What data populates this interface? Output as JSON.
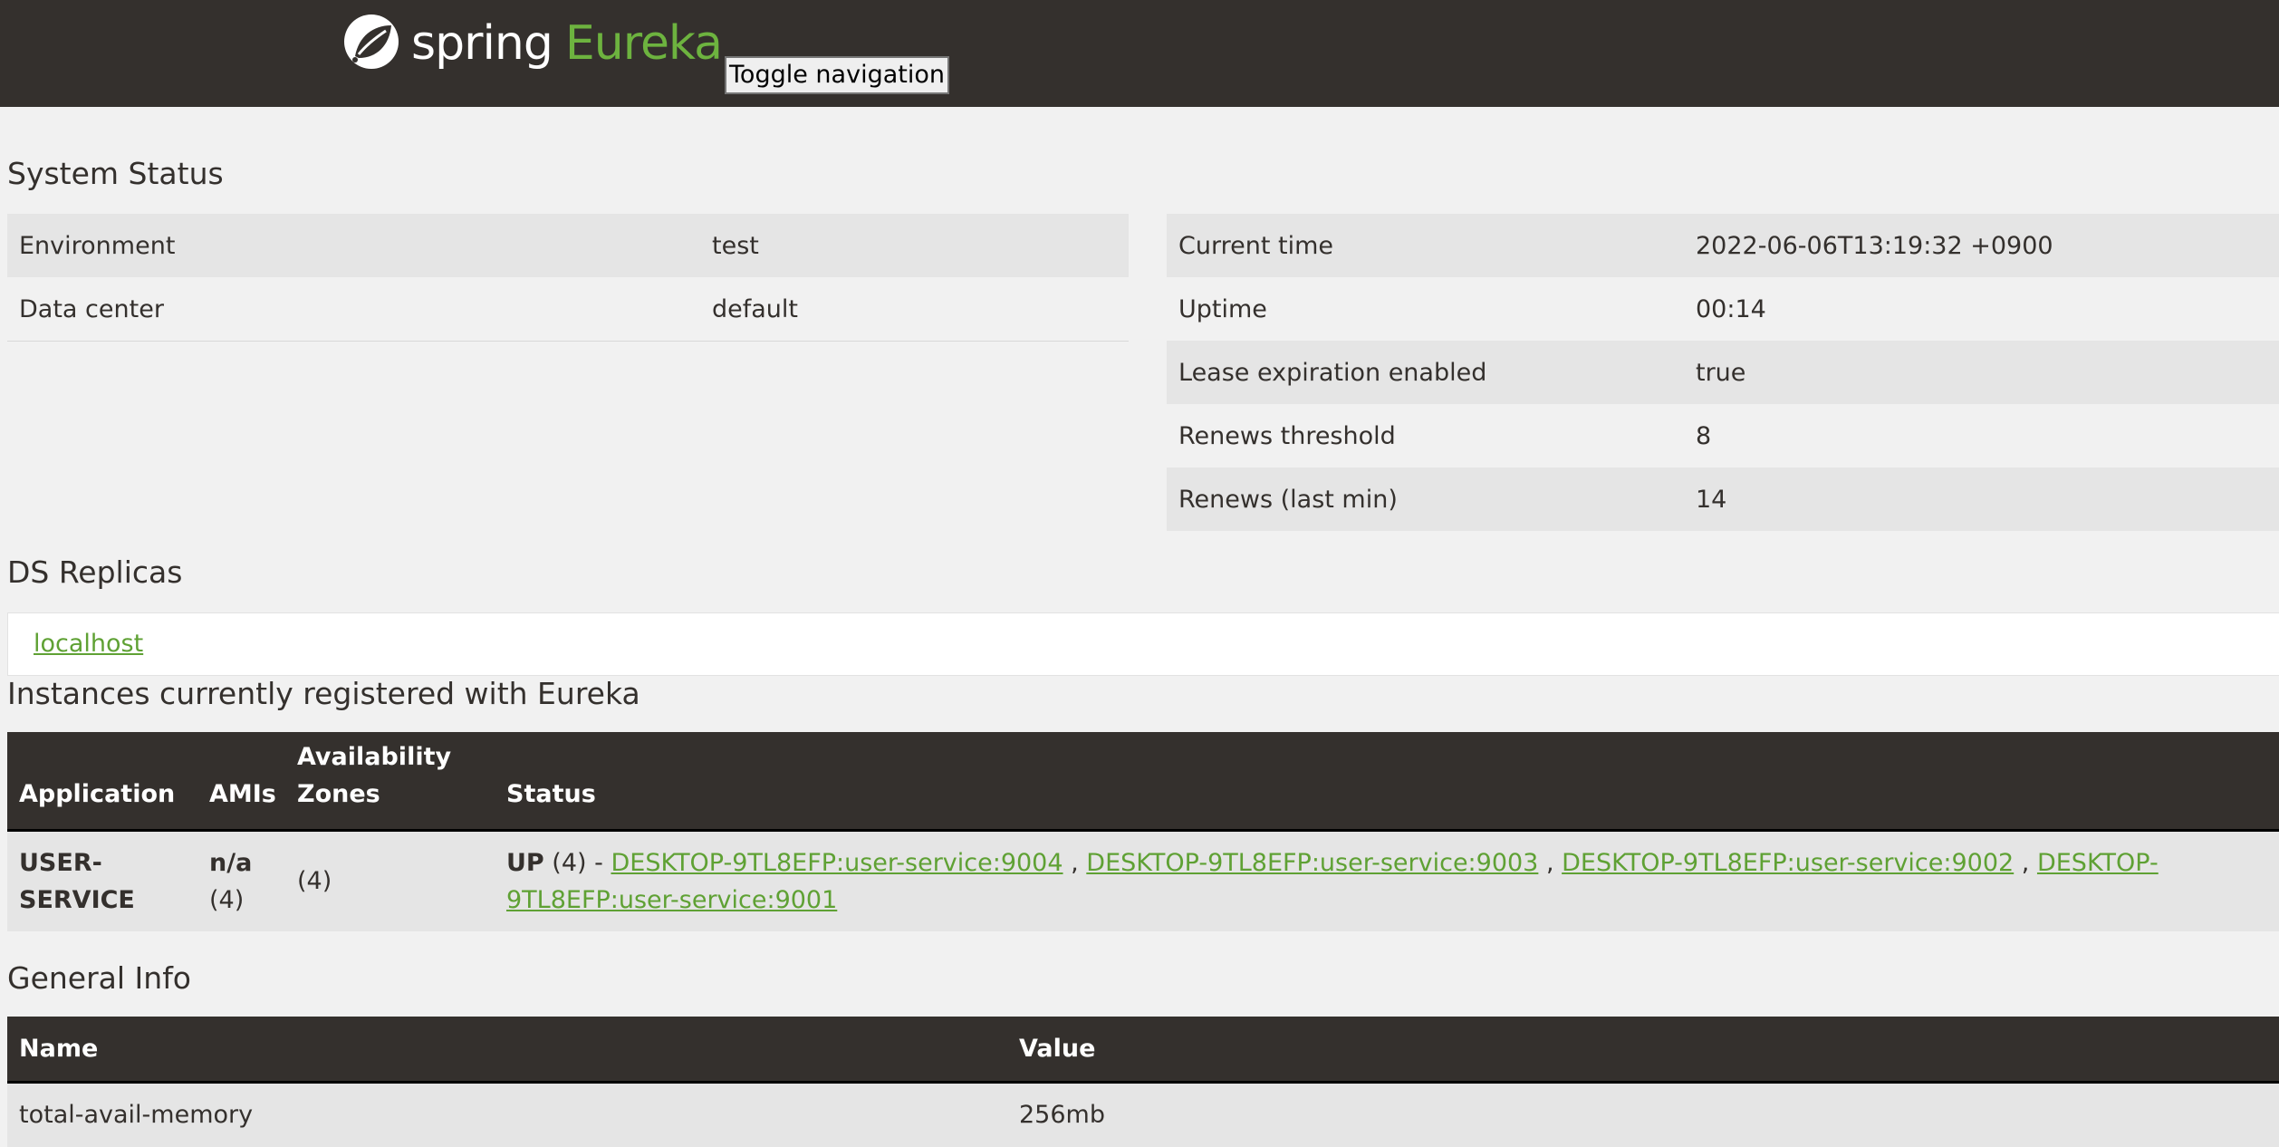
{
  "header": {
    "brand_word": "spring",
    "brand_product": "Eureka",
    "toggle_label": "Toggle navigation"
  },
  "system_status": {
    "title": "System Status",
    "left_rows": [
      {
        "label": "Environment",
        "value": "test"
      },
      {
        "label": "Data center",
        "value": "default"
      }
    ],
    "right_rows": [
      {
        "label": "Current time",
        "value": "2022-06-06T13:19:32 +0900"
      },
      {
        "label": "Uptime",
        "value": "00:14"
      },
      {
        "label": "Lease expiration enabled",
        "value": "true"
      },
      {
        "label": "Renews threshold",
        "value": "8"
      },
      {
        "label": "Renews (last min)",
        "value": "14"
      }
    ]
  },
  "ds_replicas": {
    "title": "DS Replicas",
    "link": "localhost"
  },
  "instances": {
    "title": "Instances currently registered with Eureka",
    "headers": {
      "application": "Application",
      "amis": "AMIs",
      "zones_line1": "Availability",
      "zones_line2": "Zones",
      "status": "Status"
    },
    "rows": [
      {
        "application_line1": "USER-",
        "application_line2": "SERVICE",
        "amis_value": "n/a",
        "amis_count": "(4)",
        "zones": "(4)",
        "status_state": "UP",
        "status_count": " (4) - ",
        "links": [
          "DESKTOP-9TL8EFP:user-service:9004",
          "DESKTOP-9TL8EFP:user-service:9003",
          "DESKTOP-9TL8EFP:user-service:9002",
          "DESKTOP-9TL8EFP:user-service:9001"
        ],
        "separator": " , "
      }
    ]
  },
  "general_info": {
    "title": "General Info",
    "headers": {
      "name": "Name",
      "value": "Value"
    },
    "rows": [
      {
        "name": "total-avail-memory",
        "value": "256mb"
      }
    ]
  },
  "colors": {
    "navbar": "#34302d",
    "accent_green": "#6db33f",
    "link_green": "#5fa134",
    "page_bg": "#f1f1f1",
    "row_alt": "#e5e5e5"
  }
}
